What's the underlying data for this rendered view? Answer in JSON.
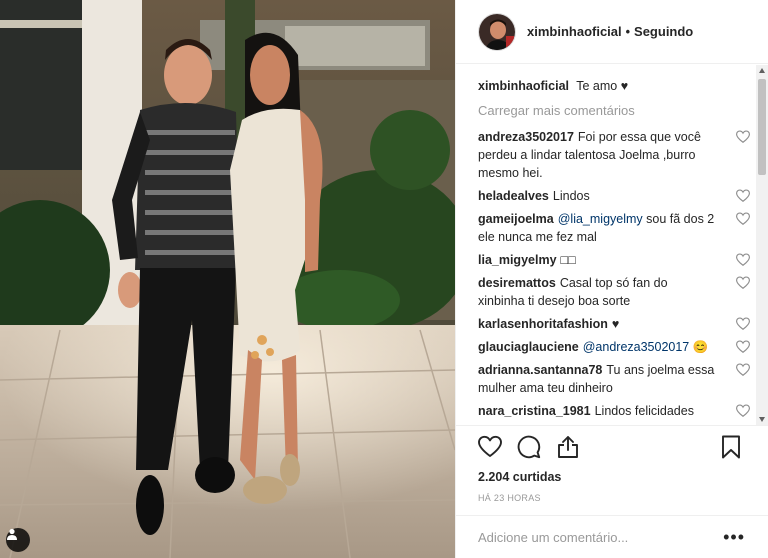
{
  "post": {
    "username": "ximbinhaoficial",
    "separator": "•",
    "follow_status": "Seguindo",
    "caption": "Te amo ♥",
    "load_more": "Carregar mais comentários",
    "likes": "2.204 curtidas",
    "time_ago": "HÁ 23 HORAS",
    "add_comment_placeholder": "Adicione um comentário...",
    "more_options": "•••"
  },
  "comments": [
    {
      "user": "andreza3502017",
      "parts": [
        {
          "t": "Foi por essa que você perdeu a lindar talentosa Joelma ,burro mesmo hei.",
          "mention": false
        }
      ]
    },
    {
      "user": "heladealves",
      "parts": [
        {
          "t": "Lindos",
          "mention": false
        }
      ]
    },
    {
      "user": "gameijoelma",
      "parts": [
        {
          "t": "@lia_migyelmy",
          "mention": true
        },
        {
          "t": " sou fã dos 2 ele nunca me fez mal",
          "mention": false
        }
      ]
    },
    {
      "user": "lia_migyelmy",
      "parts": [
        {
          "t": "□□",
          "mention": false
        }
      ]
    },
    {
      "user": "desiremattos",
      "parts": [
        {
          "t": "Casal top só fan do xinbinha ti desejo boa sorte",
          "mention": false
        }
      ]
    },
    {
      "user": "karlasenhoritafashion",
      "parts": [
        {
          "t": "♥",
          "mention": false
        }
      ]
    },
    {
      "user": "glauciaglauciene",
      "parts": [
        {
          "t": "@andreza3502017",
          "mention": true
        },
        {
          "t": " 😊",
          "mention": false
        }
      ]
    },
    {
      "user": "adrianna.santanna78",
      "parts": [
        {
          "t": "Tu ans joelma essa mulher ama teu dinheiro",
          "mention": false
        }
      ]
    },
    {
      "user": "nara_cristina_1981",
      "parts": [
        {
          "t": "Lindos felicidades",
          "mention": false
        }
      ]
    }
  ],
  "icons": {
    "like": "heart-icon",
    "comment": "comment-bubble-icon",
    "share": "share-icon",
    "save": "bookmark-icon",
    "comment_like": "heart-outline-icon",
    "user_tag": "person-tag-icon"
  },
  "colors": {
    "text": "#262626",
    "muted": "#999999",
    "mention": "#003569",
    "border": "#efefef"
  }
}
